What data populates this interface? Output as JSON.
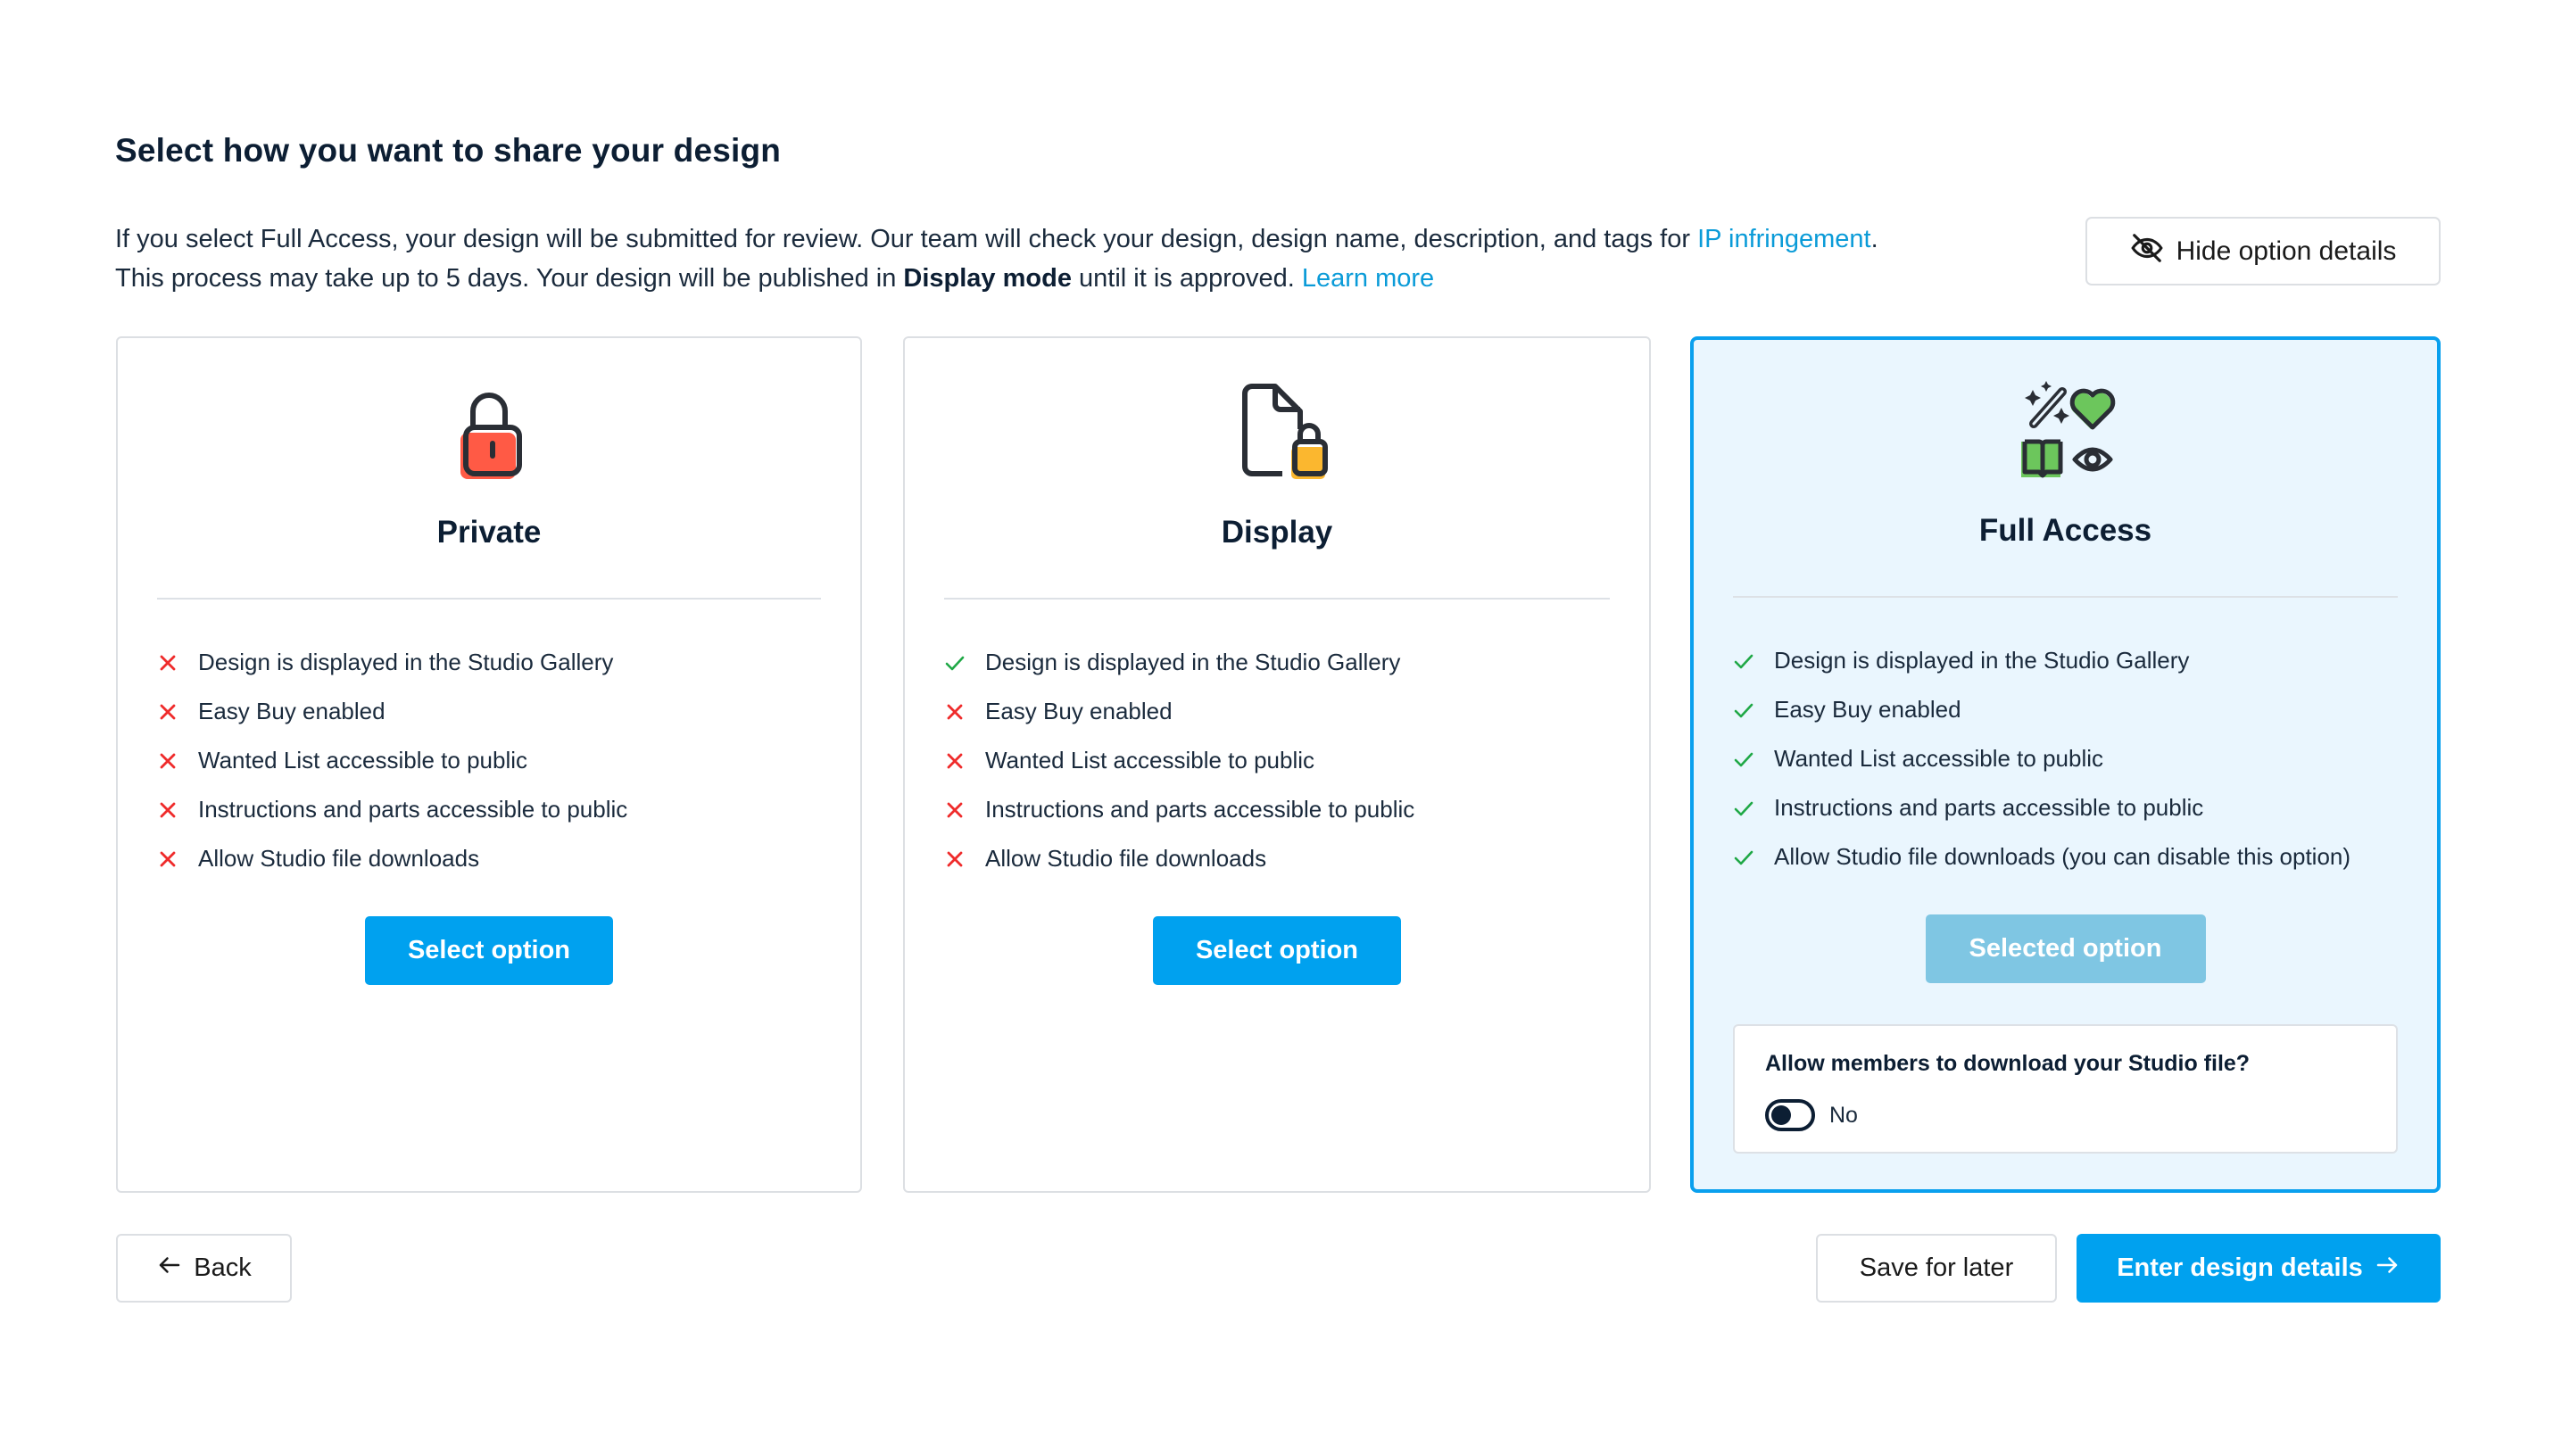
{
  "page": {
    "title": "Select how you want to share your design",
    "intro": {
      "part1": "If you select Full Access, your design will be submitted for review. Our team will check your design, design name, description, and tags for ",
      "link_ip": "IP infringement",
      "part2": ". This process may take up to 5 days. Your design will be published in ",
      "bold": "Display mode",
      "part3": " until it is approved. ",
      "link_learn": "Learn more"
    },
    "hide_details_label": "Hide option details"
  },
  "colors": {
    "primary": "#00a1ef",
    "selected_button": "#7fc6e3",
    "selected_card_bg": "#eaf6fe",
    "check": "#1fa846",
    "cross": "#ef2b2b",
    "private_accent": "#ff5a45",
    "display_accent": "#fbb72f",
    "full_access_accent": "#6cc65c"
  },
  "options": [
    {
      "id": "private",
      "title": "Private",
      "icon": "padlock-icon",
      "button_label": "Select option",
      "selected": false,
      "features": [
        {
          "label": "Design is displayed in the Studio Gallery",
          "enabled": false
        },
        {
          "label": "Easy Buy enabled",
          "enabled": false
        },
        {
          "label": "Wanted List accessible to public",
          "enabled": false
        },
        {
          "label": "Instructions and parts accessible to public",
          "enabled": false
        },
        {
          "label": "Allow Studio file downloads",
          "enabled": false
        }
      ]
    },
    {
      "id": "display",
      "title": "Display",
      "icon": "file-lock-icon",
      "button_label": "Select option",
      "selected": false,
      "features": [
        {
          "label": "Design is displayed in the Studio Gallery",
          "enabled": true
        },
        {
          "label": "Easy Buy enabled",
          "enabled": false
        },
        {
          "label": "Wanted List accessible to public",
          "enabled": false
        },
        {
          "label": "Instructions and parts accessible to public",
          "enabled": false
        },
        {
          "label": "Allow Studio file downloads",
          "enabled": false
        }
      ]
    },
    {
      "id": "full",
      "title": "Full Access",
      "icon": "full-access-icon",
      "button_label": "Selected option",
      "selected": true,
      "features": [
        {
          "label": "Design is displayed in the Studio Gallery",
          "enabled": true
        },
        {
          "label": "Easy Buy enabled",
          "enabled": true
        },
        {
          "label": "Wanted List accessible to public",
          "enabled": true
        },
        {
          "label": "Instructions and parts accessible to public",
          "enabled": true
        },
        {
          "label": "Allow Studio file downloads (you can disable this option)",
          "enabled": true
        }
      ],
      "download_panel": {
        "question": "Allow members to download your Studio file?",
        "toggle_on": false,
        "toggle_label": "No"
      }
    }
  ],
  "footer": {
    "back_label": "Back",
    "save_label": "Save for later",
    "enter_label": "Enter design details"
  }
}
